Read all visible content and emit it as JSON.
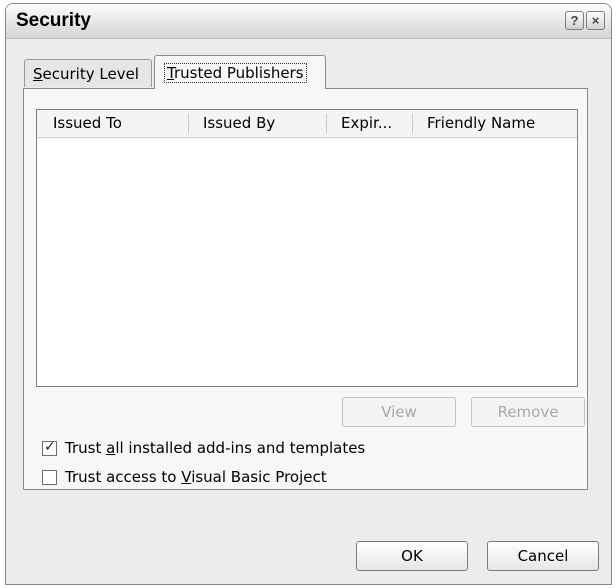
{
  "window": {
    "title": "Security",
    "help_glyph": "?",
    "close_glyph": "×"
  },
  "tabs": [
    {
      "prefix": "",
      "accel": "S",
      "rest": "ecurity Level",
      "active": false
    },
    {
      "prefix": "",
      "accel": "T",
      "rest": "rusted Publishers",
      "active": true
    }
  ],
  "publishers_list": {
    "columns": [
      "Issued To",
      "Issued By",
      "Expir...",
      "Friendly Name"
    ],
    "rows": []
  },
  "list_buttons": {
    "view": "View",
    "remove": "Remove"
  },
  "options": {
    "trust_addins": {
      "prefix": "Trust ",
      "accel": "a",
      "rest": "ll installed add-ins and templates",
      "checked": true
    },
    "trust_vba": {
      "prefix": "Trust access to ",
      "accel": "V",
      "rest": "isual Basic Project",
      "checked": false
    }
  },
  "dialog_buttons": {
    "ok": "OK",
    "cancel": "Cancel"
  },
  "glyphs": {
    "check": "✓"
  }
}
